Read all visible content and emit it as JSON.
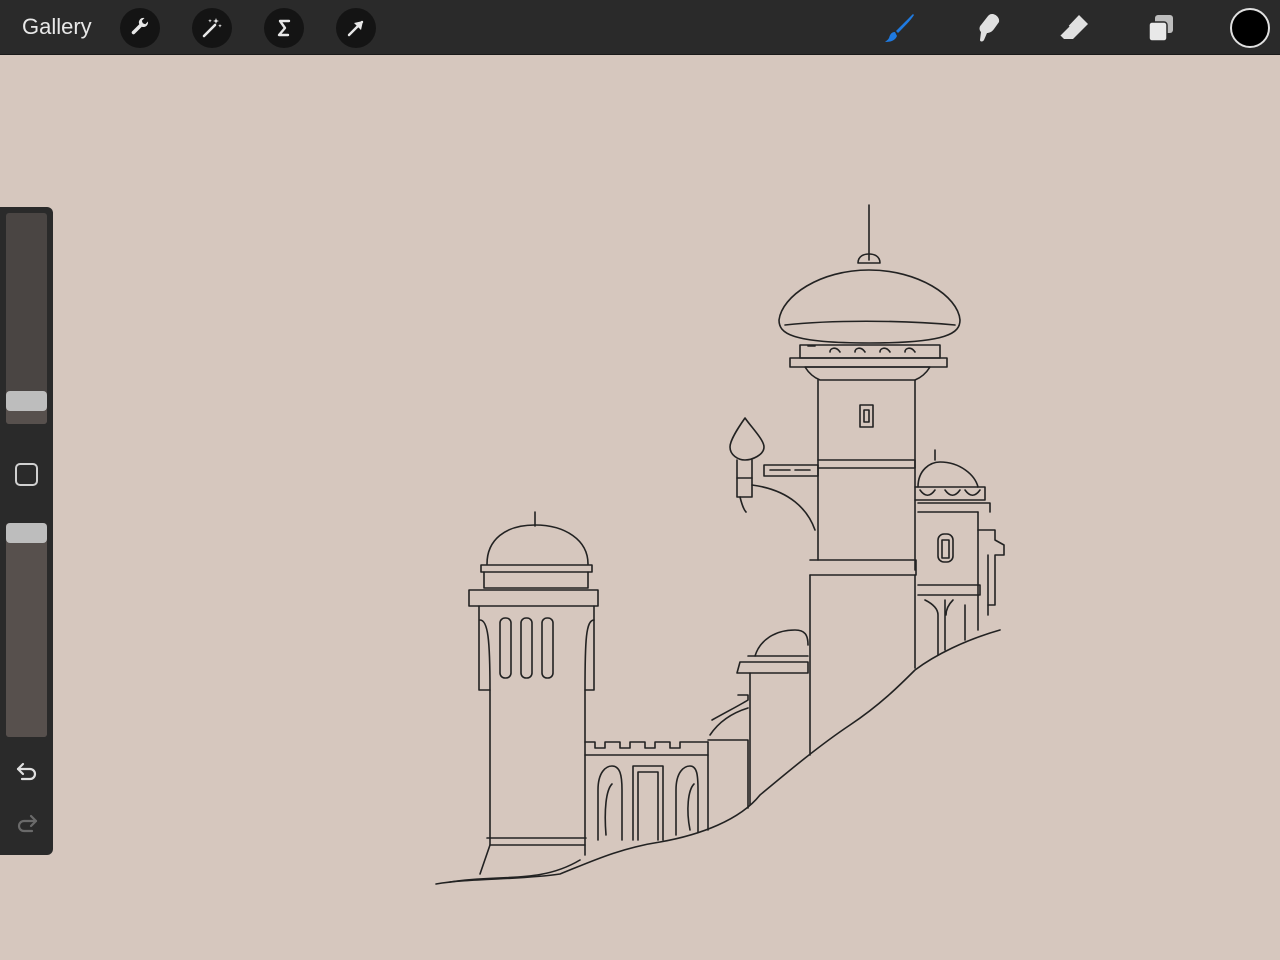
{
  "topbar": {
    "gallery_label": "Gallery",
    "left_tools": [
      {
        "name": "actions",
        "icon": "wrench-icon"
      },
      {
        "name": "adjustments",
        "icon": "magic-wand-icon"
      },
      {
        "name": "selection",
        "icon": "selection-s-icon"
      },
      {
        "name": "transform",
        "icon": "arrow-cursor-icon"
      }
    ],
    "right_tools": [
      {
        "name": "brush",
        "icon": "brush-icon",
        "active": true
      },
      {
        "name": "smudge",
        "icon": "smudge-icon",
        "active": false
      },
      {
        "name": "eraser",
        "icon": "eraser-icon",
        "active": false
      },
      {
        "name": "layers",
        "icon": "layers-icon",
        "active": false
      }
    ],
    "current_color": "#000000",
    "active_color": "#1f7ae0"
  },
  "sidebar": {
    "brush_size_level": 0.07,
    "brush_opacity_level": 1.0,
    "modify_icon": "square-icon",
    "undo_icon": "undo-icon",
    "redo_icon": "redo-icon"
  },
  "canvas": {
    "background": "#d6c7be",
    "artwork": "castle-sketch"
  }
}
